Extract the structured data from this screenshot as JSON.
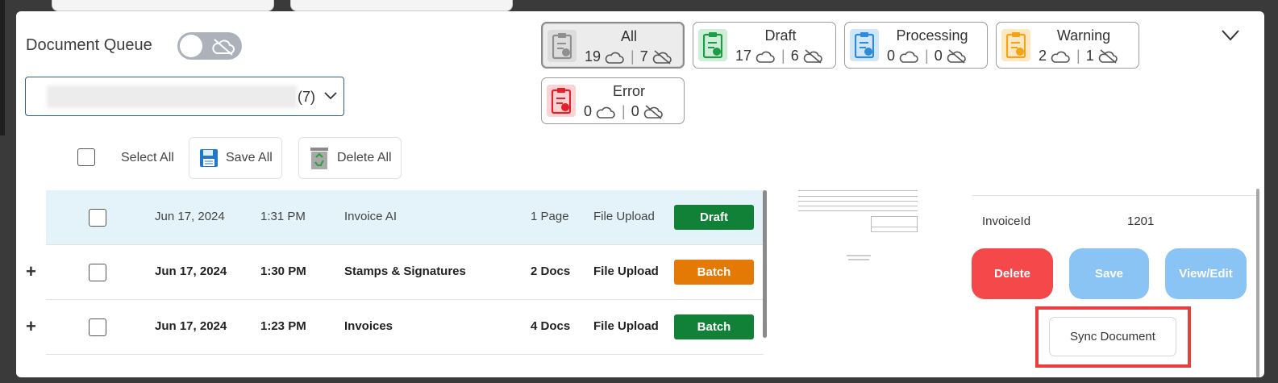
{
  "header": {
    "title": "Document Queue"
  },
  "dropdown": {
    "count": "(7)"
  },
  "status_cards": [
    {
      "label": "All",
      "cloud_count": "19",
      "offline_count": "7",
      "color": "#8f8f8f",
      "bg": "#dcdcdc"
    },
    {
      "label": "Draft",
      "cloud_count": "17",
      "offline_count": "6",
      "color": "#1e9b45",
      "bg": "#cfeed8"
    },
    {
      "label": "Processing",
      "cloud_count": "0",
      "offline_count": "0",
      "color": "#2d8bd8",
      "bg": "#cfe6f8"
    },
    {
      "label": "Warning",
      "cloud_count": "2",
      "offline_count": "1",
      "color": "#f2a417",
      "bg": "#fde8c2"
    },
    {
      "label": "Error",
      "cloud_count": "0",
      "offline_count": "0",
      "color": "#e5202a",
      "bg": "#fbd3d5"
    }
  ],
  "toolbar": {
    "select_all": "Select All",
    "save_all": "Save All",
    "delete_all": "Delete All"
  },
  "rows": [
    {
      "expander": "",
      "date": "Jun 17, 2024",
      "time": "1:31 PM",
      "name": "Invoice AI",
      "pages": "1 Page",
      "source": "File Upload",
      "status": "Draft",
      "status_color": "#128138"
    },
    {
      "expander": "+",
      "date": "Jun 17, 2024",
      "time": "1:30 PM",
      "name": "Stamps & Signatures",
      "pages": "2 Docs",
      "source": "File Upload",
      "status": "Batch",
      "status_color": "#e47a05"
    },
    {
      "expander": "+",
      "date": "Jun 17, 2024",
      "time": "1:23 PM",
      "name": "Invoices",
      "pages": "4 Docs",
      "source": "File Upload",
      "status": "Batch",
      "status_color": "#128138"
    }
  ],
  "detail": {
    "field_key": "InvoiceId",
    "field_value": "1201",
    "delete_label": "Delete",
    "save_label": "Save",
    "view_edit_label": "View/Edit",
    "sync_label": "Sync Document",
    "colors": {
      "delete": "#f5484b",
      "save": "#8ac4f5",
      "view_edit": "#8ac4f5",
      "highlight": "#e5403b"
    }
  }
}
